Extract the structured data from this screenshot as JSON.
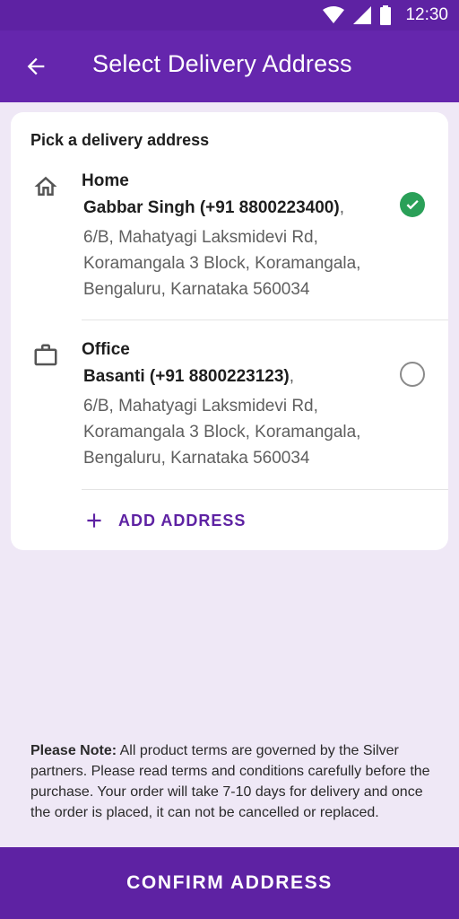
{
  "status_bar": {
    "time": "12:30",
    "icons": [
      "wifi-icon",
      "signal-icon",
      "battery-icon"
    ]
  },
  "app_bar": {
    "back_icon": "arrow-left-icon",
    "title": "Select Delivery Address"
  },
  "address_card": {
    "title": "Pick a delivery address",
    "addresses": [
      {
        "type": "Home",
        "icon": "home-icon",
        "name": "Gabbar Singh (+91 8800223400)",
        "lines": [
          "6/B, Mahatyagi Laksmidevi Rd,",
          "Koramangala 3 Block, Koramangala,",
          "Bengaluru, Karnataka 560034"
        ],
        "selected": true
      },
      {
        "type": "Office",
        "icon": "briefcase-icon",
        "name": "Basanti (+91 8800223123)",
        "lines": [
          "6/B, Mahatyagi Laksmidevi Rd,",
          "Koramangala 3 Block, Koramangala,",
          "Bengaluru, Karnataka 560034"
        ],
        "selected": false
      }
    ],
    "add_address_label": "ADD ADDRESS"
  },
  "note": {
    "label": "Please Note:",
    "text": "All product terms are governed by the Silver partners. Please read terms and conditions carefully before the purchase. Your order will take 7-10 days for delivery and once the order is placed, it can not be cancelled or replaced."
  },
  "confirm_button": {
    "label": "CONFIRM ADDRESS"
  },
  "colors": {
    "primary": "#5e22a3",
    "background": "#efe8f6",
    "selected_check": "#2aa058"
  }
}
